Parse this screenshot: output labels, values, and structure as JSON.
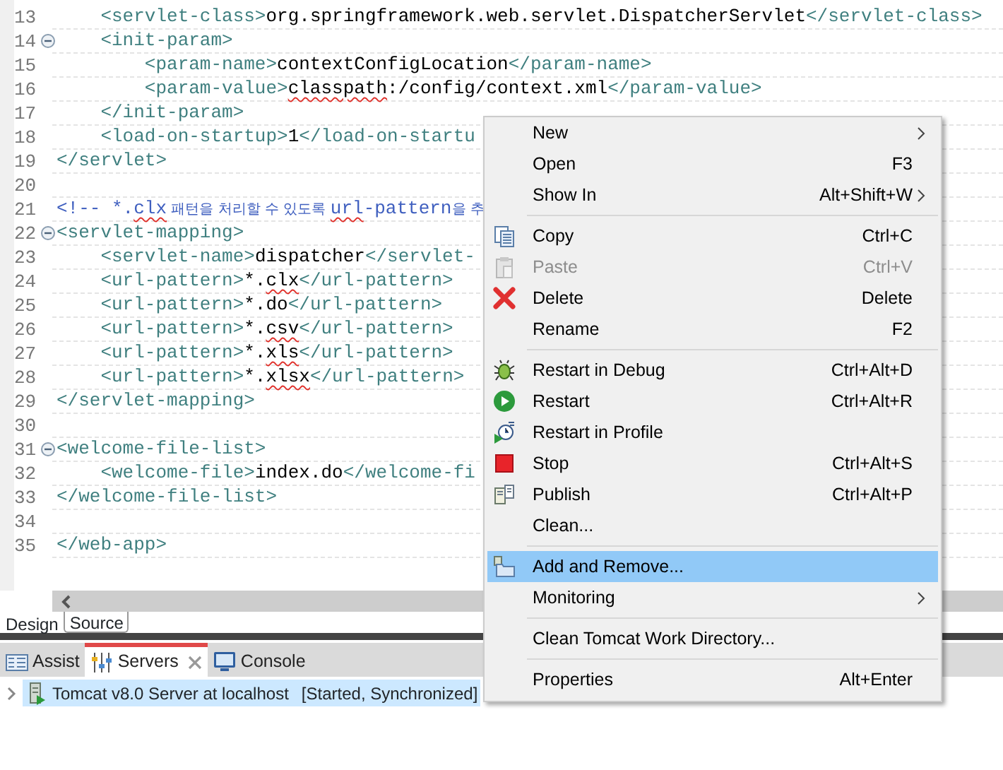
{
  "editor": {
    "lines": [
      {
        "number": "13",
        "fold": false,
        "segments": [
          {
            "kind": "tag",
            "text": "    <servlet-class>",
            "spell_error": false
          },
          {
            "kind": "value",
            "text": "org.springframework.web.servlet.DispatcherServlet",
            "spell_error": false
          },
          {
            "kind": "tag",
            "text": "</servlet-class>",
            "spell_error": false
          }
        ]
      },
      {
        "number": "14",
        "fold": true,
        "segments": [
          {
            "kind": "tag",
            "text": "    <init-param>",
            "spell_error": false
          }
        ]
      },
      {
        "number": "15",
        "fold": false,
        "segments": [
          {
            "kind": "tag",
            "text": "        <param-name>",
            "spell_error": false
          },
          {
            "kind": "value",
            "text": "contextConfigLocation",
            "spell_error": false
          },
          {
            "kind": "tag",
            "text": "</param-name>",
            "spell_error": false
          }
        ]
      },
      {
        "number": "16",
        "fold": false,
        "segments": [
          {
            "kind": "tag",
            "text": "        <param-value>",
            "spell_error": false
          },
          {
            "kind": "value",
            "text": "classpath",
            "spell_error": true
          },
          {
            "kind": "value",
            "text": ":/config/context.xml",
            "spell_error": false
          },
          {
            "kind": "tag",
            "text": "</param-value>",
            "spell_error": false
          }
        ]
      },
      {
        "number": "17",
        "fold": false,
        "segments": [
          {
            "kind": "tag",
            "text": "    </init-param>",
            "spell_error": false
          }
        ]
      },
      {
        "number": "18",
        "fold": false,
        "segments": [
          {
            "kind": "tag",
            "text": "    <load-on-startup>",
            "spell_error": false
          },
          {
            "kind": "value",
            "text": "1",
            "spell_error": false
          },
          {
            "kind": "tag",
            "text": "</load-on-startu",
            "spell_error": false
          }
        ]
      },
      {
        "number": "19",
        "fold": false,
        "segments": [
          {
            "kind": "tag",
            "text": "</servlet>",
            "spell_error": false
          }
        ]
      },
      {
        "number": "20",
        "fold": false
      },
      {
        "number": "21",
        "fold": false,
        "segments": [
          {
            "kind": "comment",
            "text": "<!-- *.",
            "spell_error": false
          },
          {
            "kind": "comment",
            "text": "clx",
            "spell_error": true
          },
          {
            "kind": "korean",
            "text": " 패턴을 처리할 수 있도록 ",
            "spell_error": false
          },
          {
            "kind": "comment",
            "text": "url",
            "spell_error": true
          },
          {
            "kind": "comment",
            "text": "-pattern",
            "spell_error": false
          },
          {
            "kind": "korean",
            "text": "을 추",
            "spell_error": false
          }
        ]
      },
      {
        "number": "22",
        "fold": true,
        "segments": [
          {
            "kind": "tag",
            "text": "<servlet-mapping>",
            "spell_error": false
          }
        ]
      },
      {
        "number": "23",
        "fold": false,
        "segments": [
          {
            "kind": "tag",
            "text": "    <servlet-name>",
            "spell_error": false
          },
          {
            "kind": "value",
            "text": "dispatcher",
            "spell_error": false
          },
          {
            "kind": "tag",
            "text": "</servlet-",
            "spell_error": false
          }
        ]
      },
      {
        "number": "24",
        "fold": false,
        "segments": [
          {
            "kind": "tag",
            "text": "    <url-pattern>",
            "spell_error": false
          },
          {
            "kind": "value",
            "text": "*.",
            "spell_error": false
          },
          {
            "kind": "value",
            "text": "clx",
            "spell_error": true
          },
          {
            "kind": "tag",
            "text": "</url-pattern>",
            "spell_error": false
          }
        ]
      },
      {
        "number": "25",
        "fold": false,
        "segments": [
          {
            "kind": "tag",
            "text": "    <url-pattern>",
            "spell_error": false
          },
          {
            "kind": "value",
            "text": "*.do",
            "spell_error": false
          },
          {
            "kind": "tag",
            "text": "</url-pattern>",
            "spell_error": false
          }
        ]
      },
      {
        "number": "26",
        "fold": false,
        "segments": [
          {
            "kind": "tag",
            "text": "    <url-pattern>",
            "spell_error": false
          },
          {
            "kind": "value",
            "text": "*.",
            "spell_error": false
          },
          {
            "kind": "value",
            "text": "csv",
            "spell_error": true
          },
          {
            "kind": "tag",
            "text": "</url-pattern>",
            "spell_error": false
          }
        ]
      },
      {
        "number": "27",
        "fold": false,
        "segments": [
          {
            "kind": "tag",
            "text": "    <url-pattern>",
            "spell_error": false
          },
          {
            "kind": "value",
            "text": "*.",
            "spell_error": false
          },
          {
            "kind": "value",
            "text": "xls",
            "spell_error": true
          },
          {
            "kind": "tag",
            "text": "</url-pattern>",
            "spell_error": false
          }
        ]
      },
      {
        "number": "28",
        "fold": false,
        "segments": [
          {
            "kind": "tag",
            "text": "    <url-pattern>",
            "spell_error": false
          },
          {
            "kind": "value",
            "text": "*.",
            "spell_error": false
          },
          {
            "kind": "value",
            "text": "xlsx",
            "spell_error": true
          },
          {
            "kind": "tag",
            "text": "</url-pattern>",
            "spell_error": false
          }
        ]
      },
      {
        "number": "29",
        "fold": false,
        "segments": [
          {
            "kind": "tag",
            "text": "</servlet-mapping>",
            "spell_error": false
          }
        ]
      },
      {
        "number": "30",
        "fold": false
      },
      {
        "number": "31",
        "fold": true,
        "segments": [
          {
            "kind": "tag",
            "text": "<welcome-file-list>",
            "spell_error": false
          }
        ]
      },
      {
        "number": "32",
        "fold": false,
        "segments": [
          {
            "kind": "tag",
            "text": "    <welcome-file>",
            "spell_error": false
          },
          {
            "kind": "value",
            "text": "index.do",
            "spell_error": false
          },
          {
            "kind": "tag",
            "text": "</welcome-fi",
            "spell_error": false
          }
        ]
      },
      {
        "number": "33",
        "fold": false,
        "segments": [
          {
            "kind": "tag",
            "text": "</welcome-file-list>",
            "spell_error": false
          }
        ]
      },
      {
        "number": "34",
        "fold": false
      },
      {
        "number": "35",
        "fold": false,
        "segments": [
          {
            "kind": "tag",
            "text": "</web-app>",
            "spell_error": false
          }
        ]
      }
    ]
  },
  "editor_tabs": [
    {
      "label": "Design",
      "selected": false
    },
    {
      "label": "Source",
      "selected": true
    }
  ],
  "view_tabs": [
    {
      "label": "Assist",
      "selected": false
    },
    {
      "label": "Servers",
      "selected": true
    },
    {
      "label": "Console",
      "selected": false
    }
  ],
  "servers": [
    {
      "name": "Tomcat v8.0 Server at localhost",
      "status": "[Started, Synchronized]",
      "selected": true
    }
  ],
  "context_menu": {
    "items": [
      {
        "kind": "item",
        "label": "New",
        "submenu": true,
        "disabled": false,
        "selected": false
      },
      {
        "kind": "item",
        "label": "Open",
        "shortcut": "F3",
        "submenu": false,
        "disabled": false,
        "selected": false
      },
      {
        "kind": "item",
        "label": "Show In",
        "shortcut": "Alt+Shift+W",
        "submenu": true,
        "disabled": false,
        "selected": false
      },
      {
        "kind": "separator"
      },
      {
        "kind": "item",
        "label": "Copy",
        "shortcut": "Ctrl+C",
        "submenu": false,
        "disabled": false,
        "selected": false
      },
      {
        "kind": "item",
        "label": "Paste",
        "shortcut": "Ctrl+V",
        "submenu": false,
        "disabled": true,
        "selected": false
      },
      {
        "kind": "item",
        "label": "Delete",
        "shortcut": "Delete",
        "submenu": false,
        "disabled": false,
        "selected": false
      },
      {
        "kind": "item",
        "label": "Rename",
        "shortcut": "F2",
        "submenu": false,
        "disabled": false,
        "selected": false
      },
      {
        "kind": "separator"
      },
      {
        "kind": "item",
        "label": "Restart in Debug",
        "shortcut": "Ctrl+Alt+D",
        "submenu": false,
        "disabled": false,
        "selected": false
      },
      {
        "kind": "item",
        "label": "Restart",
        "shortcut": "Ctrl+Alt+R",
        "submenu": false,
        "disabled": false,
        "selected": false
      },
      {
        "kind": "item",
        "label": "Restart in Profile",
        "submenu": false,
        "disabled": false,
        "selected": false
      },
      {
        "kind": "item",
        "label": "Stop",
        "shortcut": "Ctrl+Alt+S",
        "submenu": false,
        "disabled": false,
        "selected": false
      },
      {
        "kind": "item",
        "label": "Publish",
        "shortcut": "Ctrl+Alt+P",
        "submenu": false,
        "disabled": false,
        "selected": false
      },
      {
        "kind": "item",
        "label": "Clean...",
        "submenu": false,
        "disabled": false,
        "selected": false
      },
      {
        "kind": "separator"
      },
      {
        "kind": "item",
        "label": "Add and Remove...",
        "submenu": false,
        "disabled": false,
        "selected": true
      },
      {
        "kind": "item",
        "label": "Monitoring",
        "submenu": true,
        "disabled": false,
        "selected": false
      },
      {
        "kind": "separator"
      },
      {
        "kind": "item",
        "label": "Clean Tomcat Work Directory...",
        "submenu": false,
        "disabled": false,
        "selected": false
      },
      {
        "kind": "separator"
      },
      {
        "kind": "item",
        "label": "Properties",
        "shortcut": "Alt+Enter",
        "submenu": false,
        "disabled": false,
        "selected": false
      }
    ]
  }
}
